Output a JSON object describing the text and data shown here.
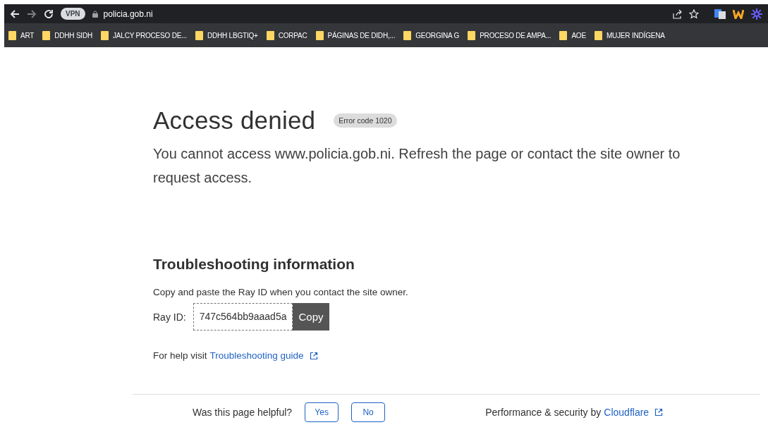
{
  "browser": {
    "address": "policia.gob.ni",
    "vpn_badge": "VPN",
    "bookmarks": [
      "ART",
      "DDHH SIDH",
      "JALCY PROCESO DE...",
      "DDHH LBGTIQ+",
      "CORPAC",
      "PÁGINAS DE DIDH,...",
      "GEORGINA G",
      "PROCESO DE AMPA...",
      "AOE",
      "MUJER INDÍGENA"
    ]
  },
  "page": {
    "title": "Access denied",
    "error_badge": "Error code 1020",
    "message": "You cannot access www.policia.gob.ni. Refresh the page or contact the site owner to request access.",
    "troubleshooting": {
      "heading": "Troubleshooting information",
      "instructions": "Copy and paste the Ray ID when you contact the site owner.",
      "ray_label": "Ray ID:",
      "ray_id": "747c564bb9aaad5a",
      "copy_button": "Copy",
      "help_prefix": "For help visit",
      "help_link": "Troubleshooting guide"
    },
    "footer": {
      "question": "Was this page helpful?",
      "buttons": [
        "Yes",
        "No"
      ],
      "credit_prefix": "Performance & security by",
      "credit_link": "Cloudflare"
    }
  }
}
